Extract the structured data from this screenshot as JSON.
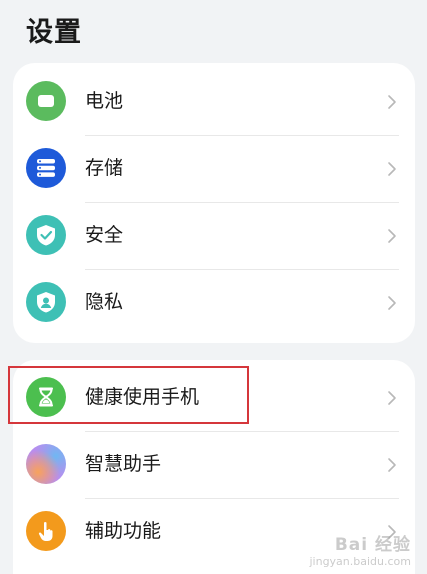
{
  "page": {
    "title": "设置"
  },
  "groups": [
    {
      "items": [
        {
          "label": "电池",
          "icon": "battery-icon",
          "color": "#5bbb5e"
        },
        {
          "label": "存储",
          "icon": "storage-icon",
          "color": "#1e5ad9"
        },
        {
          "label": "安全",
          "icon": "shield-icon",
          "color": "#3ec0b5"
        },
        {
          "label": "隐私",
          "icon": "privacy-shield-icon",
          "color": "#3ec0b5"
        }
      ]
    },
    {
      "items": [
        {
          "label": "健康使用手机",
          "icon": "hourglass-icon",
          "color": "#4cbf4f"
        },
        {
          "label": "智慧助手",
          "icon": "assistant-orb-icon",
          "color": "#c98ee0"
        },
        {
          "label": "辅助功能",
          "icon": "hand-touch-icon",
          "color": "#f39a1c"
        }
      ]
    }
  ],
  "highlight": {
    "color": "#d5363b"
  },
  "watermark": {
    "line1": "Bai 经验",
    "line2": "jingyan.baidu.com"
  }
}
